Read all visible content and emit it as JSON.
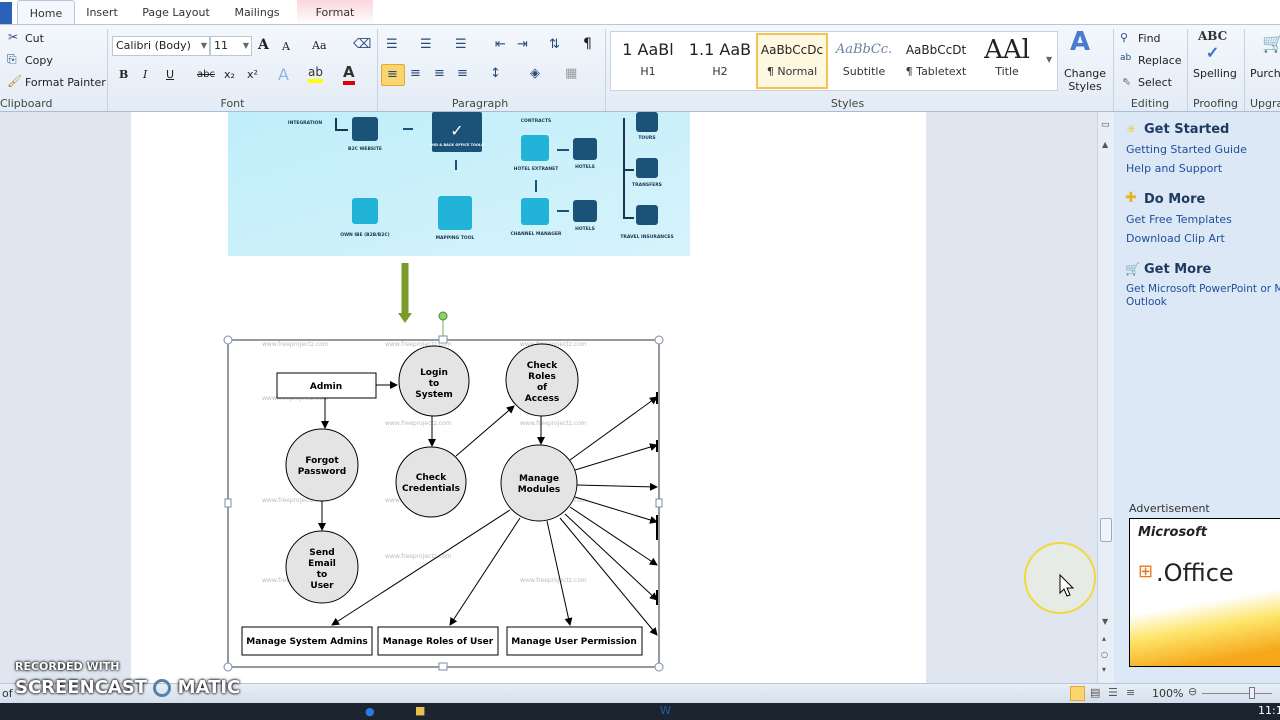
{
  "ribbon": {
    "tabs": [
      {
        "label": "Home",
        "active": true
      },
      {
        "label": "Insert"
      },
      {
        "label": "Page Layout"
      },
      {
        "label": "Mailings"
      },
      {
        "label": "Format",
        "contextual": true
      }
    ],
    "clipboard": {
      "cut": "Cut",
      "copy": "Copy",
      "format_painter": "Format Painter",
      "label": "Clipboard"
    },
    "font": {
      "name": "Calibri (Body)",
      "size": "11",
      "label": "Font",
      "bold": "B",
      "italic": "I",
      "underline": "U",
      "strike": "abc",
      "sub": "x₂",
      "sup": "x²",
      "grow": "A",
      "shrink": "A",
      "case": "Aa",
      "highlight_color": "#ffff00",
      "font_color": "#e00000"
    },
    "paragraph": {
      "label": "Paragraph",
      "pilcrow": "¶"
    },
    "styles": {
      "label": "Styles",
      "items": [
        {
          "preview": "1  AaBl",
          "name": "H1"
        },
        {
          "preview": "1.1  AaB",
          "name": "H2"
        },
        {
          "preview": "AaBbCcDc",
          "name": "¶ Normal",
          "selected": true
        },
        {
          "preview": "AaBbCc.",
          "name": "Subtitle"
        },
        {
          "preview": "AaBbCcDt",
          "name": "¶ Tabletext"
        },
        {
          "preview": "AAl",
          "name": "Title"
        }
      ],
      "change_styles": "Change Styles"
    },
    "editing": {
      "label": "Editing",
      "find": "Find",
      "replace": "Replace",
      "select": "Select"
    },
    "proofing": {
      "label": "Proofing",
      "spelling": "Spelling"
    },
    "upgrade": {
      "label": "Upgra",
      "purchase": "Purch"
    }
  },
  "document": {
    "image_labels": {
      "integration": "INTEGRATION",
      "b2c": "B2C WEBSITE",
      "backoffice": "MID & BACK OFFICE TOOLS",
      "contracts": "CONTRACTS",
      "hotel_extranet": "HOTEL EXTRANET",
      "hotels1": "HOTELS",
      "hotels2": "HOTELS",
      "tours": "TOURS",
      "transfers": "TRANSFERS",
      "own_ibe": "OWN IBE (B2B/B2C)",
      "mapping": "MAPPING TOOL",
      "channel": "CHANNEL MANAGER",
      "insurance": "TRAVEL INSURANCES"
    },
    "watermark": "www.freeprojectz.com",
    "diagram": {
      "admin": "Admin",
      "login": [
        "Login",
        "to",
        "System"
      ],
      "check_roles": [
        "Check",
        "Roles",
        "of",
        "Access"
      ],
      "forgot": [
        "Forgot",
        "Password"
      ],
      "check_cred": [
        "Check",
        "Credentials"
      ],
      "manage_modules": [
        "Manage",
        "Modules"
      ],
      "send_email": [
        "Send",
        "Email",
        "to",
        "User"
      ],
      "boxes": [
        "Manage System Admins",
        "Manage Roles of User",
        "Manage User Permission"
      ]
    }
  },
  "task_pane": {
    "sections": [
      {
        "title": "Get Started",
        "links": [
          "Getting Started Guide",
          "Help and Support"
        ]
      },
      {
        "title": "Do More",
        "links": [
          "Get Free Templates",
          "Download Clip Art"
        ]
      },
      {
        "title": "Get More",
        "links": [
          "Get Microsoft PowerPoint or Micr",
          "Outlook"
        ]
      }
    ],
    "ad_label": "Advertisement",
    "ad_brand": "Microsoft",
    "ad_product": ".Office"
  },
  "status": {
    "zoom": "100%",
    "page_fragment": "of"
  },
  "watermark": {
    "line1": "RECORDED WITH",
    "line2": "SCREENCAST",
    "line3": "MATIC"
  },
  "taskbar": {
    "clock": "11:1"
  }
}
